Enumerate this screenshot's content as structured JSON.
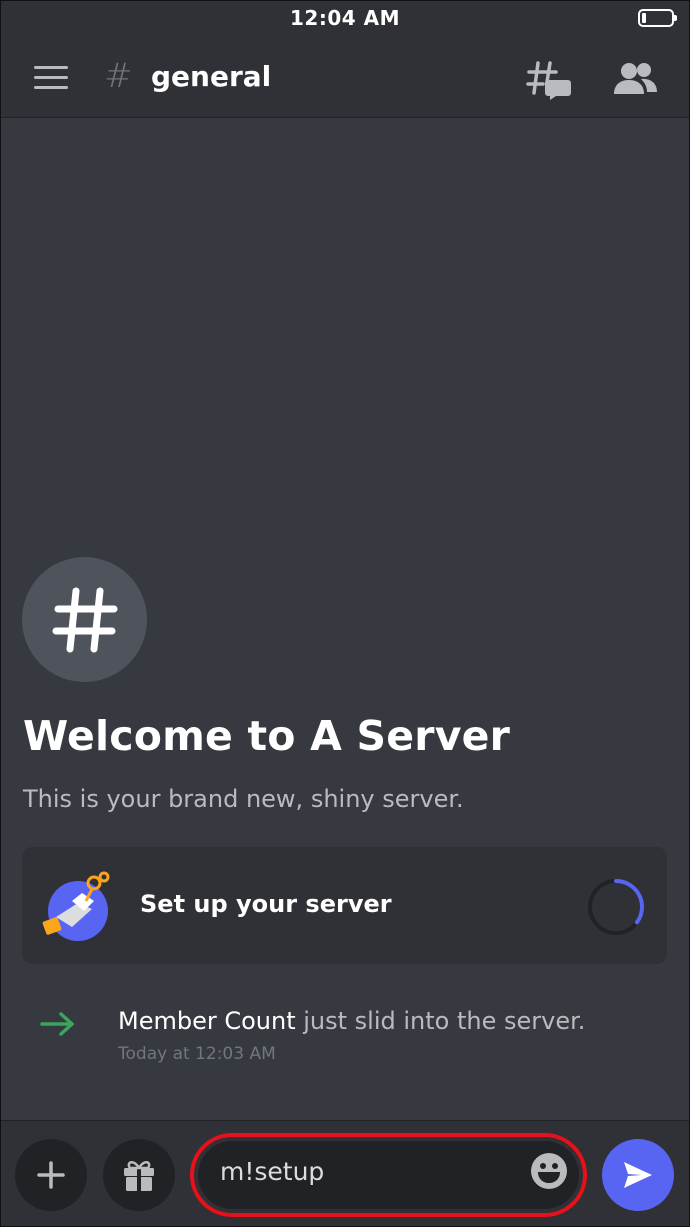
{
  "status_bar": {
    "time": "12:04 AM",
    "battery_level": 0.15
  },
  "header": {
    "channel_name": "general",
    "icons": [
      "menu-icon",
      "hash-icon",
      "threads-icon",
      "members-icon"
    ]
  },
  "welcome": {
    "title": "Welcome to A Server",
    "subtitle": "This is your brand new, shiny server.",
    "avatar_icon": "hash-icon"
  },
  "setup_card": {
    "label": "Set up your server",
    "progress": 0.35
  },
  "system_message": {
    "user": "Member Count",
    "text": " just slid into the server.",
    "timestamp": "Today at 12:03 AM"
  },
  "composer": {
    "input_value": "m!setup",
    "icons": [
      "plus-icon",
      "gift-icon",
      "emoji-icon",
      "send-icon"
    ]
  },
  "colors": {
    "background": "#36393f",
    "panel": "#2f3136",
    "accent": "#5865f2",
    "highlight": "#e8101a",
    "join_arrow": "#3ba55c"
  }
}
